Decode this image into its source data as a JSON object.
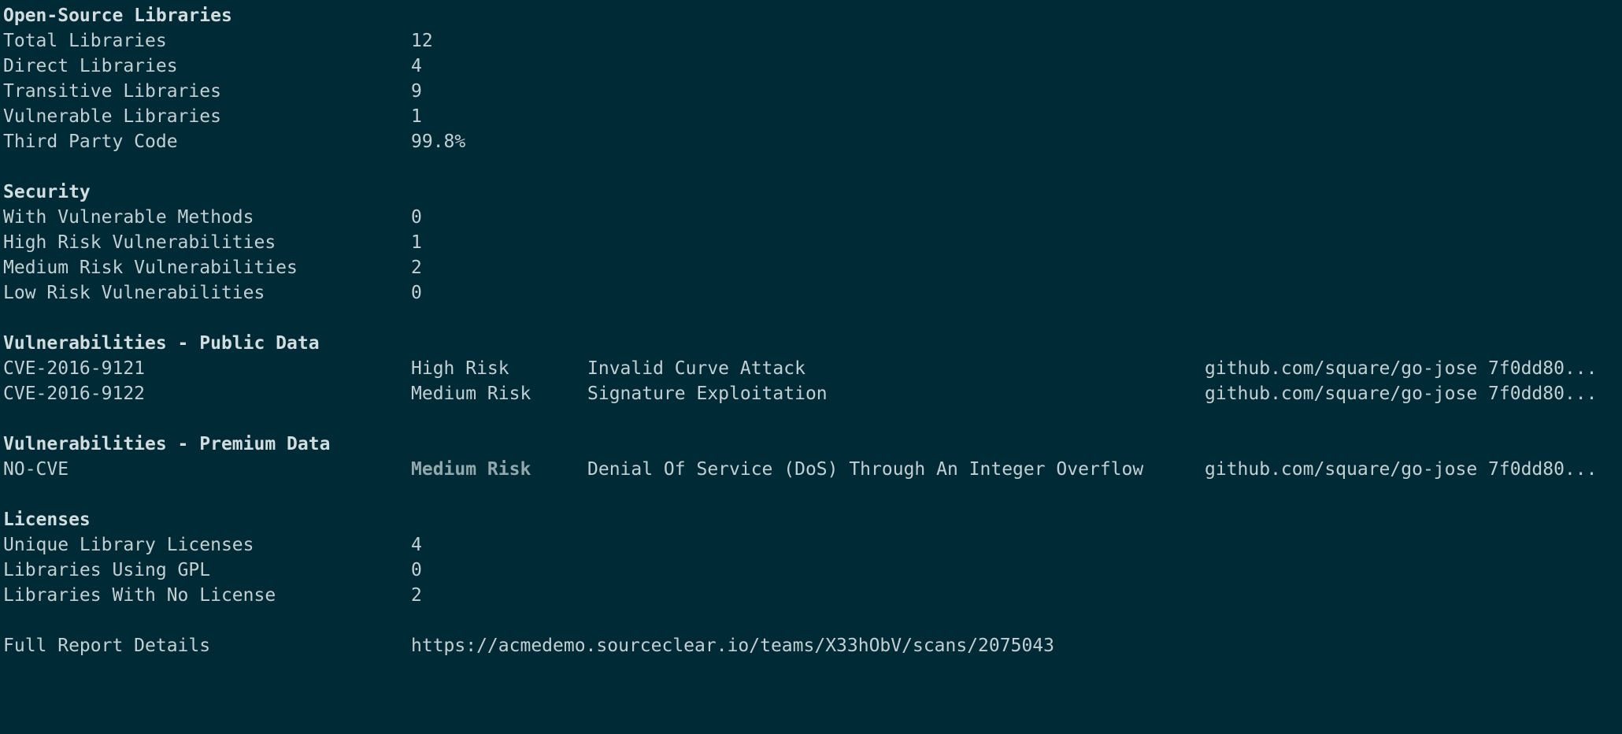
{
  "open_source": {
    "heading": "Open-Source Libraries",
    "rows": [
      {
        "label": "Total Libraries",
        "value": "12"
      },
      {
        "label": "Direct Libraries",
        "value": "4"
      },
      {
        "label": "Transitive Libraries",
        "value": "9"
      },
      {
        "label": "Vulnerable Libraries",
        "value": "1"
      },
      {
        "label": "Third Party Code",
        "value": "99.8%"
      }
    ]
  },
  "security": {
    "heading": "Security",
    "rows": [
      {
        "label": "With Vulnerable Methods",
        "value": "0"
      },
      {
        "label": "High Risk Vulnerabilities",
        "value": "1"
      },
      {
        "label": "Medium Risk Vulnerabilities",
        "value": "2"
      },
      {
        "label": "Low Risk Vulnerabilities",
        "value": "0"
      }
    ]
  },
  "public_data": {
    "heading": "Vulnerabilities - Public Data",
    "rows": [
      {
        "id": "CVE-2016-9121",
        "risk": "High Risk",
        "title": "Invalid Curve Attack",
        "library": "github.com/square/go-jose 7f0dd80..."
      },
      {
        "id": "CVE-2016-9122",
        "risk": "Medium Risk",
        "title": "Signature Exploitation",
        "library": "github.com/square/go-jose 7f0dd80..."
      }
    ]
  },
  "premium_data": {
    "heading": "Vulnerabilities - Premium Data",
    "rows": [
      {
        "id": "NO-CVE",
        "risk": "Medium Risk",
        "title": "Denial Of Service (DoS) Through An Integer Overflow",
        "library": "github.com/square/go-jose 7f0dd80..."
      }
    ]
  },
  "licenses": {
    "heading": "Licenses",
    "rows": [
      {
        "label": "Unique Library Licenses",
        "value": "4"
      },
      {
        "label": "Libraries Using GPL",
        "value": "0"
      },
      {
        "label": "Libraries With No License",
        "value": "2"
      }
    ]
  },
  "report": {
    "label": "Full Report Details",
    "url": "https://acmedemo.sourceclear.io/teams/X33hObV/scans/2075043"
  },
  "colors": {
    "background": "#002b36",
    "text": "#c4cfd1",
    "muted_bold": "#93a8ac"
  }
}
